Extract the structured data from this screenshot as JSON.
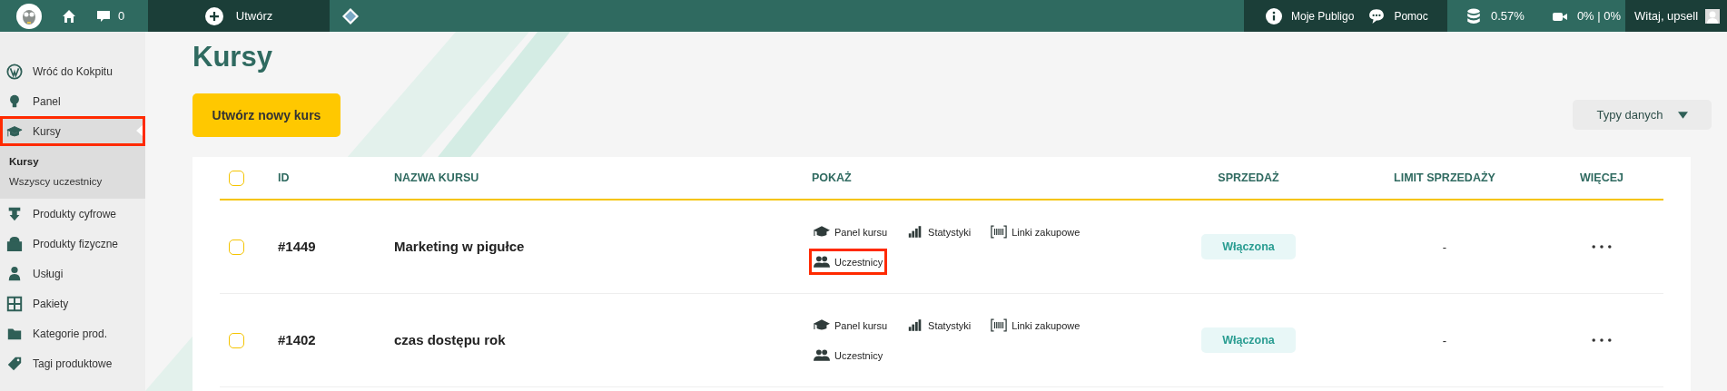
{
  "topbar": {
    "comments_count": "0",
    "create_label": "Utwórz",
    "links": [
      {
        "kind": "info",
        "label": "Moje Publigo"
      },
      {
        "kind": "chat",
        "label": "Pomoc"
      }
    ],
    "stats": [
      {
        "kind": "storage",
        "text": "0.57%"
      },
      {
        "kind": "video",
        "text": "0% | 0%"
      }
    ],
    "greeting": "Witaj, upsell"
  },
  "sidebar": {
    "items": [
      {
        "kind": "wordpress",
        "label": "Wróć do Kokpitu",
        "selected": false,
        "highlighted": false
      },
      {
        "kind": "bulb",
        "label": "Panel",
        "selected": false,
        "highlighted": false
      },
      {
        "kind": "cap",
        "label": "Kursy",
        "selected": true,
        "highlighted": true,
        "children": [
          {
            "label": "Kursy",
            "selected": true
          },
          {
            "label": "Wszyscy uczestnicy",
            "selected": false
          }
        ]
      },
      {
        "kind": "download",
        "label": "Produkty cyfrowe",
        "selected": false,
        "highlighted": false
      },
      {
        "kind": "bag",
        "label": "Produkty fizyczne",
        "selected": false,
        "highlighted": false
      },
      {
        "kind": "person",
        "label": "Usługi",
        "selected": false,
        "highlighted": false
      },
      {
        "kind": "grid",
        "label": "Pakiety",
        "selected": false,
        "highlighted": false
      },
      {
        "kind": "folder",
        "label": "Kategorie prod.",
        "selected": false,
        "highlighted": false
      },
      {
        "kind": "tag",
        "label": "Tagi produktowe",
        "selected": false,
        "highlighted": false
      }
    ]
  },
  "page": {
    "title": "Kursy",
    "create_button": "Utwórz nowy kurs",
    "filter_dropdown": "Typy danych"
  },
  "table": {
    "select_all_checked": false,
    "columns": [
      "ID",
      "NAZWA KURSU",
      "POKAŻ",
      "SPRZEDAŻ",
      "LIMIT SPRZEDAŻY",
      "WIĘCEJ"
    ],
    "rows": [
      {
        "checked": false,
        "id": "#1449",
        "name": "Marketing w pigułce",
        "actions": [
          {
            "kind": "panel",
            "label": "Panel kursu",
            "highlighted": false
          },
          {
            "kind": "stats",
            "label": "Statystyki",
            "highlighted": false
          },
          {
            "kind": "links",
            "label": "Linki zakupowe",
            "highlighted": false
          },
          {
            "kind": "users",
            "label": "Uczestnicy",
            "highlighted": true
          }
        ],
        "sales": "Włączona",
        "limit": "-"
      },
      {
        "checked": false,
        "id": "#1402",
        "name": "czas dostępu rok",
        "actions": [
          {
            "kind": "panel",
            "label": "Panel kursu",
            "highlighted": false
          },
          {
            "kind": "stats",
            "label": "Statystyki",
            "highlighted": false
          },
          {
            "kind": "links",
            "label": "Linki zakupowe",
            "highlighted": false
          },
          {
            "kind": "users",
            "label": "Uczestnicy",
            "highlighted": false
          }
        ],
        "sales": "Włączona",
        "limit": "-"
      }
    ]
  }
}
